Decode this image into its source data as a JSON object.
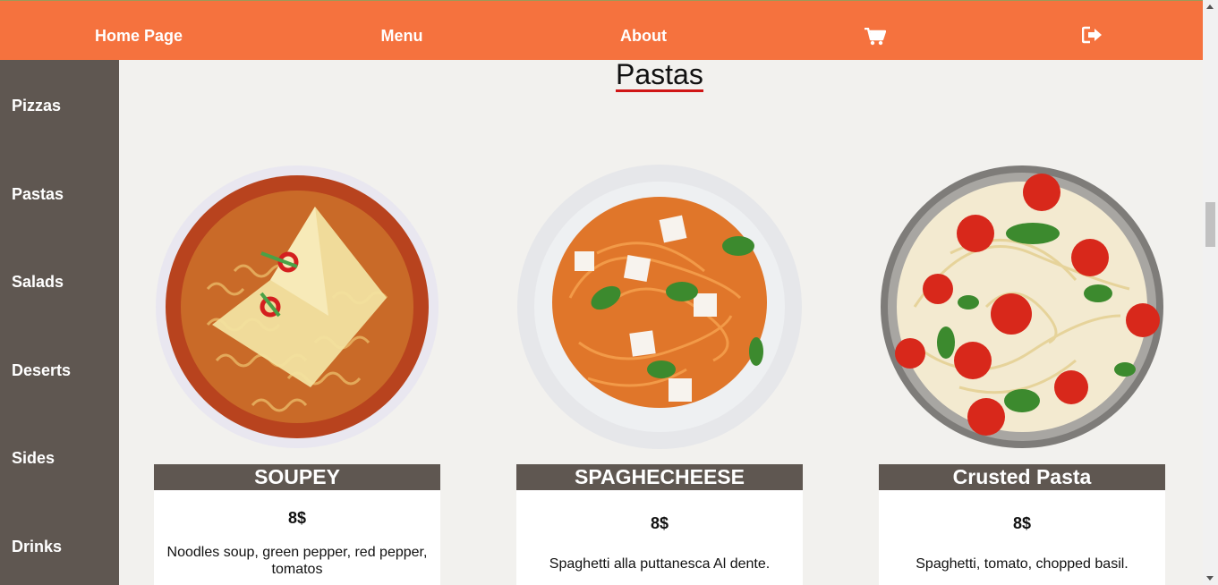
{
  "nav": {
    "home": "Home Page",
    "menu": "Menu",
    "about": "About",
    "cart_icon": "shopping-cart-icon",
    "logout_icon": "sign-out-icon"
  },
  "sidebar": {
    "items": [
      {
        "label": "Pizzas"
      },
      {
        "label": "Pastas"
      },
      {
        "label": "Salads"
      },
      {
        "label": "Deserts"
      },
      {
        "label": "Sides"
      },
      {
        "label": "Drinks"
      }
    ]
  },
  "section": {
    "title": "Pastas"
  },
  "dishes": [
    {
      "name": "SOUPEY",
      "price": "8$",
      "description": "Noodles soup, green pepper, red pepper, tomatos"
    },
    {
      "name": "SPAGHECHEESE",
      "price": "8$",
      "description": "Spaghetti alla puttanesca Al dente."
    },
    {
      "name": "Crusted Pasta",
      "price": "8$",
      "description": "Spaghetti, tomato, chopped basil."
    }
  ],
  "colors": {
    "topbar": "#f5723e",
    "sidebar": "#5f5751",
    "background": "#f2f1ee",
    "title_underline": "#d01616"
  }
}
